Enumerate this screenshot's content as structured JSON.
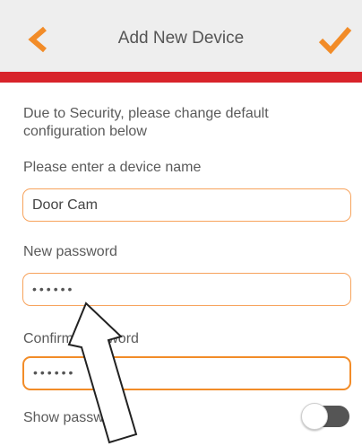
{
  "header": {
    "title": "Add New Device",
    "back_icon": "chevron-left-icon",
    "confirm_icon": "checkmark-icon"
  },
  "colors": {
    "accent": "#f28c28",
    "red_bar": "#d8232a"
  },
  "form": {
    "intro": "Due to Security, please change default configuration below",
    "device_name_label": "Please enter a device name",
    "device_name_value": "Door Cam",
    "new_password_label": "New password",
    "new_password_value": "••••••",
    "confirm_password_label": "Confirm password",
    "confirm_password_value": "••••••",
    "show_password_label": "Show password",
    "show_password_on": false
  }
}
